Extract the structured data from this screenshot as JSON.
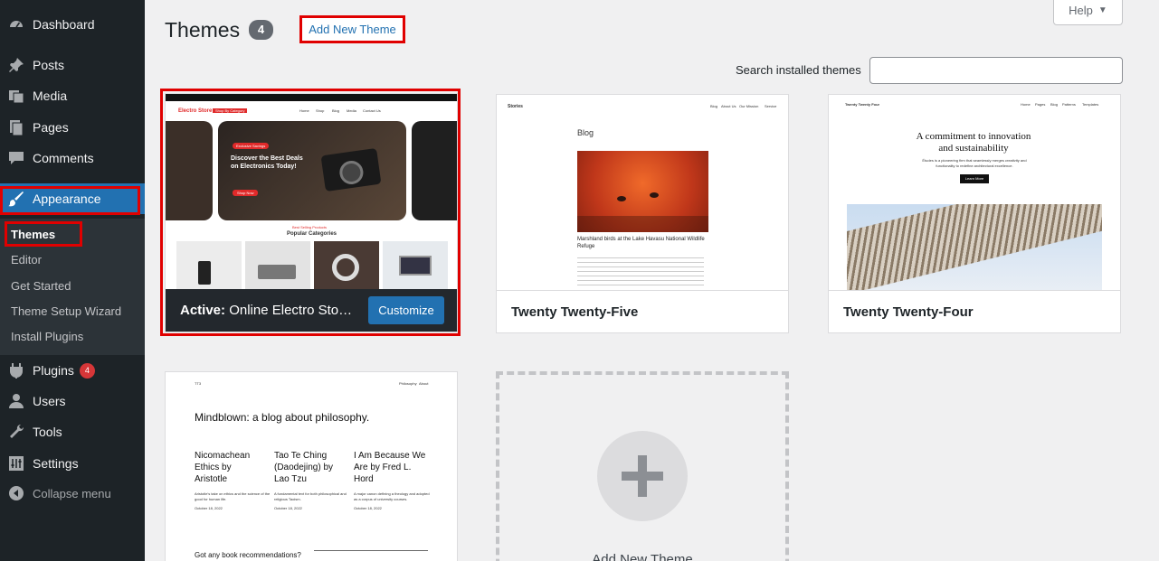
{
  "sidebar": {
    "items": [
      {
        "label": "Dashboard",
        "icon": "dashboard-icon"
      },
      {
        "label": "Posts",
        "icon": "pin-icon"
      },
      {
        "label": "Media",
        "icon": "media-icon"
      },
      {
        "label": "Pages",
        "icon": "pages-icon"
      },
      {
        "label": "Comments",
        "icon": "comments-icon"
      },
      {
        "label": "Appearance",
        "icon": "paintbrush-icon"
      },
      {
        "label": "Plugins",
        "icon": "plugin-icon",
        "badge": "4"
      },
      {
        "label": "Users",
        "icon": "users-icon"
      },
      {
        "label": "Tools",
        "icon": "wrench-icon"
      },
      {
        "label": "Settings",
        "icon": "settings-icon"
      },
      {
        "label": "Collapse menu",
        "icon": "collapse-icon"
      }
    ],
    "submenu": [
      "Themes",
      "Editor",
      "Get Started",
      "Theme Setup Wizard",
      "Install Plugins"
    ]
  },
  "header": {
    "title": "Themes",
    "count": "4",
    "add_new": "Add New Theme",
    "help": "Help",
    "search_label": "Search installed themes",
    "search_value": ""
  },
  "themes": {
    "active": {
      "prefix": "Active:",
      "name": "Online Electro Stor…",
      "customize": "Customize",
      "shot": {
        "brand": "Electro Store",
        "hero_badge": "Exclusive Savings",
        "hero_title_1": "Discover the Best Deals",
        "hero_title_2": "on Electronics Today!",
        "hero_btn": "Shop Now",
        "small_title": "Best Selling Products",
        "section": "Popular Categories",
        "category_btn": "Shop By Category",
        "nav": [
          "Home",
          "Shop",
          "Blog",
          "Media",
          "Contact Us"
        ]
      }
    },
    "tt5": {
      "name": "Twenty Twenty-Five",
      "shot": {
        "site": "Stories",
        "nav": [
          "Blog",
          "About Us",
          "Our Mission",
          "Service"
        ],
        "heading": "Blog",
        "caption": "Marshland birds at the Lake Havasu National Wildlife Refuge"
      }
    },
    "tt4": {
      "name": "Twenty Twenty-Four",
      "shot": {
        "site": "Twenty Twenty Four",
        "nav": [
          "Home",
          "Pages",
          "Blog",
          "Patterns",
          "Templates"
        ],
        "headline_1": "A commitment to innovation",
        "headline_2": "and sustainability",
        "sub": "Études is a pioneering firm that seamlessly merges creativity and functionality to redefine architectural excellence.",
        "btn": "Learn More"
      }
    },
    "tt3": {
      "shot": {
        "site": "TT3",
        "nav": [
          "Philosophy",
          "About"
        ],
        "headline": "Mindblown: a blog about philosophy.",
        "posts": [
          {
            "title": "Nicomachean Ethics by Aristotle",
            "excerpt": "Aristotle's take on ethics and the science of the good for human life.",
            "date": "October 18, 2022"
          },
          {
            "title": "Tao Te Ching (Daodejing) by Lao Tzu",
            "excerpt": "A fundamental text for both philosophical and religious Taoism.",
            "date": "October 18, 2022"
          },
          {
            "title": "I Am Because We Are by Fred L. Hord",
            "excerpt": "A major canon defining a theology and adopted as a corpus of university courses.",
            "date": "October 18, 2022"
          }
        ],
        "footer_q": "Got any book recommendations?"
      }
    },
    "add_new_card": "Add New Theme"
  }
}
